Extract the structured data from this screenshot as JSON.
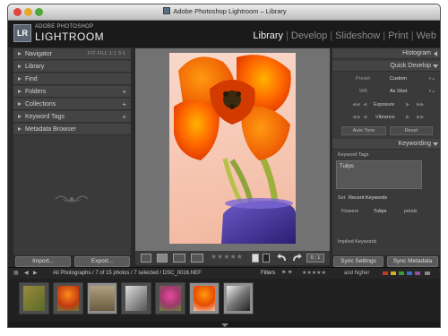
{
  "window": {
    "title": "Adobe Photoshop Lightroom – Library"
  },
  "identity": {
    "badge": "LR",
    "brand_small": "ADOBE PHOTOSHOP",
    "brand_big": "LIGHTROOM",
    "modules": [
      "Library",
      "Develop",
      "Slideshow",
      "Print",
      "Web"
    ],
    "active_module": "Library"
  },
  "left_panel": {
    "navigator": {
      "label": "Navigator",
      "options": "FIT FILL 1:1 3:1"
    },
    "items": [
      {
        "label": "Library",
        "plus": ""
      },
      {
        "label": "Find",
        "plus": ""
      },
      {
        "label": "Folders",
        "plus": "+"
      },
      {
        "label": "Collections",
        "plus": "+"
      },
      {
        "label": "Keyword Tags",
        "plus": "+"
      },
      {
        "label": "Metadata Browser",
        "plus": ""
      }
    ],
    "import_label": "Import...",
    "export_label": "Export..."
  },
  "right_panel": {
    "histogram": "Histogram",
    "quick_develop": {
      "title": "Quick Develop",
      "preset_label": "Preset",
      "preset_value": "Custom",
      "wb_label": "WB",
      "wb_value": "As Shot",
      "exposure_label": "Exposure",
      "vibrance_label": "Vibrance",
      "auto_tone": "Auto Tone",
      "reset": "Reset"
    },
    "keywording": {
      "title": "Keywording",
      "tags_label": "Keyword Tags",
      "tags_value": "Tulips",
      "set_label": "Set",
      "set_value": "Recent Keywords",
      "suggested": [
        "Flowers",
        "Tulips",
        "petals"
      ],
      "implied_label": "Implied Keywords"
    },
    "sync_settings": "Sync Settings",
    "sync_metadata": "Sync Metadata"
  },
  "toolbar": {
    "stars": "★★★★★",
    "zoom": "0 : 1"
  },
  "filterbar": {
    "path": "All Photographs / 7 of 15 photos / 7 selected / DSC_0016.NEF",
    "filters": "Filters",
    "and_higher": "and higher"
  },
  "colors": {
    "window_bg": "#2a2a2a",
    "panel_bg": "#3a3a3a",
    "center_bg": "#727272",
    "filmstrip_bg": "#202020",
    "label_red": "#c0392b",
    "label_yellow": "#d4b020",
    "label_green": "#3c9a3c",
    "label_blue": "#3a6fc0",
    "label_purple": "#8e4fa8"
  }
}
